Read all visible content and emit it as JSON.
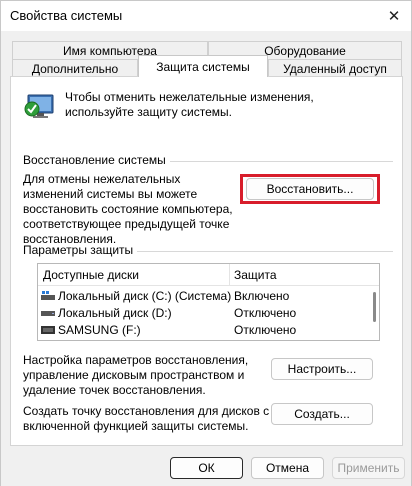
{
  "window": {
    "title": "Свойства системы"
  },
  "tabs": {
    "row1": [
      {
        "label": "Имя компьютера"
      },
      {
        "label": "Оборудование"
      }
    ],
    "row2": [
      {
        "label": "Дополнительно"
      },
      {
        "label": "Защита системы",
        "active": true
      },
      {
        "label": "Удаленный доступ"
      }
    ]
  },
  "info": {
    "text": "Чтобы отменить нежелательные изменения, используйте защиту системы."
  },
  "restore": {
    "group_title": "Восстановление системы",
    "description": "Для отмены нежелательных изменений системы вы можете восстановить состояние компьютера, соответствующее предыдущей точке восстановления.",
    "button_label": "Восстановить...",
    "highlight_color": "#d81d2b"
  },
  "protection": {
    "group_title": "Параметры защиты",
    "columns": [
      "Доступные диски",
      "Защита"
    ],
    "rows": [
      {
        "name": "Локальный диск (C:) (Система)",
        "status": "Включено",
        "icon": "system-drive-icon"
      },
      {
        "name": "Локальный диск (D:)",
        "status": "Отключено",
        "icon": "drive-icon"
      },
      {
        "name": "SAMSUNG (F:)",
        "status": "Отключено",
        "icon": "usb-drive-icon"
      }
    ]
  },
  "configure": {
    "description": "Настройка параметров восстановления, управление дисковым пространством и удаление точек восстановления.",
    "button_label": "Настроить..."
  },
  "create": {
    "description": "Создать точку восстановления для дисков с включенной функцией защиты системы.",
    "button_label": "Создать..."
  },
  "footer": {
    "ok": "ОК",
    "cancel": "Отмена",
    "apply": "Применить"
  }
}
